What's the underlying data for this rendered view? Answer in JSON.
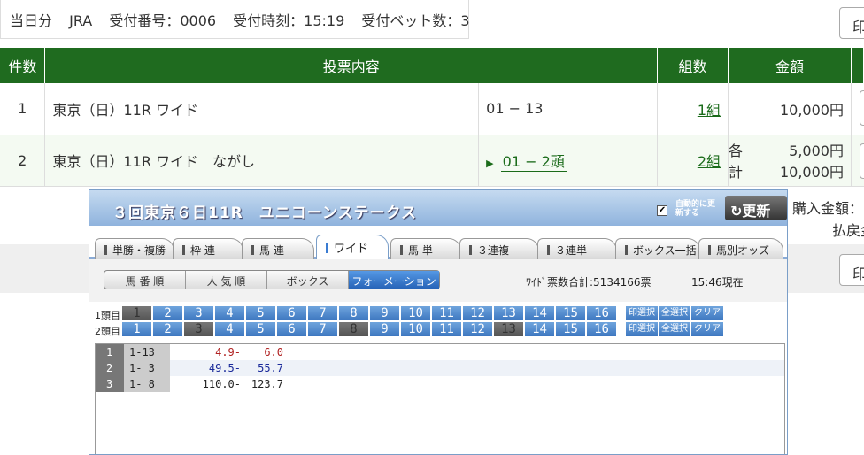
{
  "info": {
    "day": "当日分",
    "org": "JRA",
    "receipt_no": "受付番号：0006",
    "receipt_time": "受付時刻：15:19",
    "bet_count": "受付ベット数：3"
  },
  "print_label": "印",
  "table": {
    "headers": [
      "件数",
      "投票内容",
      "組数",
      "金額"
    ],
    "rows": [
      {
        "num": "1",
        "content": "東京（日）11R ワイド",
        "selection": "01 − 13",
        "combos": "1組",
        "amount": "10,000円"
      },
      {
        "num": "2",
        "content": "東京（日）11R ワイド　ながし",
        "selection": "01 − 2頭",
        "combos": "2組",
        "each_label": "各",
        "each_amount": "5,000円",
        "total_label": "計",
        "total_amount": "10,000円"
      }
    ]
  },
  "summary": {
    "purchase": "購入金額：",
    "refund": "払戻金"
  },
  "popup": {
    "title": "３回東京６日11R　ユニコーンステークス",
    "auto_update": "自動的に更新する",
    "auto_checked": "✔",
    "refresh": "更新",
    "tabs": [
      "単勝・複勝",
      "枠 連",
      "馬 連",
      "ワイド",
      "馬 単",
      "３連複",
      "３連単",
      "ボックス一括",
      "馬別オッズ"
    ],
    "modes": [
      "馬 番 順",
      "人 気 順",
      "ボックス",
      "フォーメーション"
    ],
    "votes": "ﾜｲﾄﾞ票数合計:5134166票",
    "asof": "15:46現在",
    "row1_label": "1頭目",
    "row2_label": "2頭目",
    "numbers": [
      "1",
      "2",
      "3",
      "4",
      "5",
      "6",
      "7",
      "8",
      "9",
      "10",
      "11",
      "12",
      "13",
      "14",
      "15",
      "16"
    ],
    "actions": [
      "印選択",
      "全選択",
      "クリア"
    ],
    "odds": [
      {
        "idx": "1",
        "combo": "1-13",
        "low": "4.9-",
        "high": "6.0",
        "color": "#b02020"
      },
      {
        "idx": "2",
        "combo": "1- 3",
        "low": "49.5-",
        "high": "55.7",
        "color": "#1a2a9a"
      },
      {
        "idx": "3",
        "combo": "1- 8",
        "low": "110.0-",
        "high": "123.7",
        "color": "#222222"
      }
    ]
  }
}
